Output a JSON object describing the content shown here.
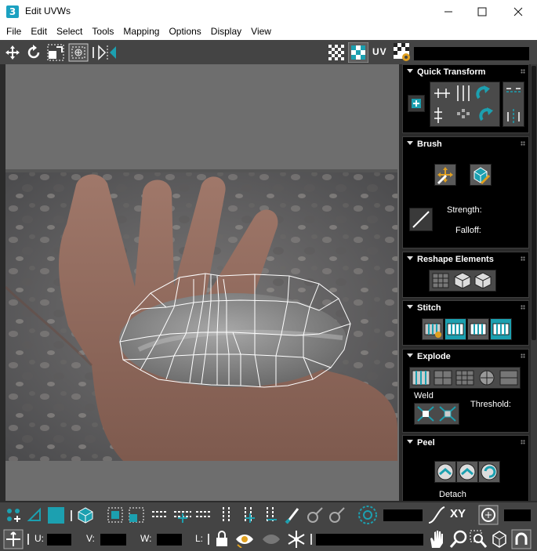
{
  "window": {
    "title": "Edit UVWs",
    "app_icon_label": "3",
    "controls": [
      "minimize",
      "maximize",
      "close"
    ]
  },
  "menu": [
    "File",
    "Edit",
    "Select",
    "Tools",
    "Mapping",
    "Options",
    "Display",
    "View"
  ],
  "toolbar": {
    "uv_label": "UV",
    "tools": [
      "move-icon",
      "rotate-icon",
      "scale-icon",
      "freeform-icon",
      "mirror-icon",
      "checker-icon",
      "checker-toggle-icon",
      "uv-space-dropdown",
      "texture-settings-icon"
    ]
  },
  "panel": {
    "quick_transform": {
      "title": "Quick Transform"
    },
    "brush": {
      "title": "Brush",
      "strength_label": "Strength:",
      "falloff_label": "Falloff:"
    },
    "reshape": {
      "title": "Reshape Elements"
    },
    "stitch": {
      "title": "Stitch"
    },
    "explode": {
      "title": "Explode",
      "weld_label": "Weld",
      "threshold_label": "Threshold:"
    },
    "peel": {
      "title": "Peel",
      "detach_label": "Detach"
    }
  },
  "bottom": {
    "xy_label": "XY",
    "u_label": "U:",
    "v_label": "V:",
    "w_label": "W:",
    "l_label": "L:",
    "u_value": "",
    "v_value": "",
    "w_value": ""
  },
  "colors": {
    "accent": "#1ca0b0",
    "toolbar": "#444444",
    "panel": "#000000"
  }
}
